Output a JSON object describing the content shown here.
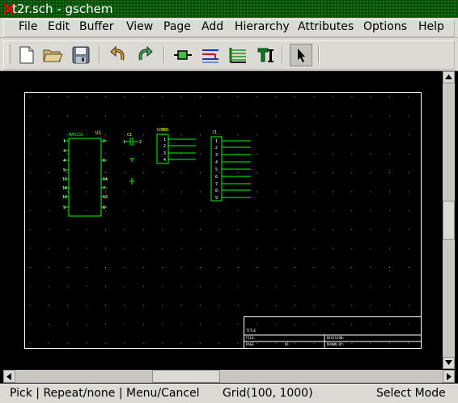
{
  "window": {
    "title": "t2r.sch - gschem"
  },
  "menu": {
    "items": [
      "File",
      "Edit",
      "Buffer",
      "View",
      "Page",
      "Add",
      "Hierarchy",
      "Attributes",
      "Options",
      "Help"
    ]
  },
  "toolbar": {
    "buttons": [
      "new-file-icon",
      "open-folder-icon",
      "save-icon",
      "undo-icon",
      "redo-icon",
      "add-component-icon",
      "add-net-icon",
      "add-bus-icon",
      "add-text-icon",
      "select-pointer-icon"
    ],
    "active": "select-pointer-icon"
  },
  "schematic": {
    "u1": {
      "refdes": "U1",
      "value": "MAX232",
      "left_pins": [
        "1",
        "3",
        "4",
        "5",
        "11",
        "10",
        "12",
        "9"
      ],
      "right_pins": [
        "2",
        "6",
        "14",
        "7",
        "13",
        "8"
      ]
    },
    "c1": {
      "refdes": "C1",
      "pins": [
        "1",
        "2"
      ]
    },
    "conn": {
      "refdes": "CONN1",
      "pins": [
        "1",
        "2",
        "3",
        "4"
      ]
    },
    "j1": {
      "refdes": "J1",
      "pins": [
        "1",
        "2",
        "3",
        "4",
        "5",
        "6",
        "7",
        "8",
        "9"
      ]
    },
    "titleblock": {
      "title_label": "TITLE",
      "file_label": "FILE:",
      "page_label": "PAGE",
      "of_label": "OF",
      "revision_label": "REVISION:",
      "drawn_label": "DRAWN BY:"
    }
  },
  "status": {
    "mouse": "Pick | Repeat/none | Menu/Cancel",
    "grid": "Grid(100, 1000)",
    "mode": "Select Mode"
  },
  "colors": {
    "background": "#000000",
    "component": "#00ff00",
    "net": "#ffffff",
    "frame": "#ffffff",
    "refdes": "#ffff00"
  }
}
